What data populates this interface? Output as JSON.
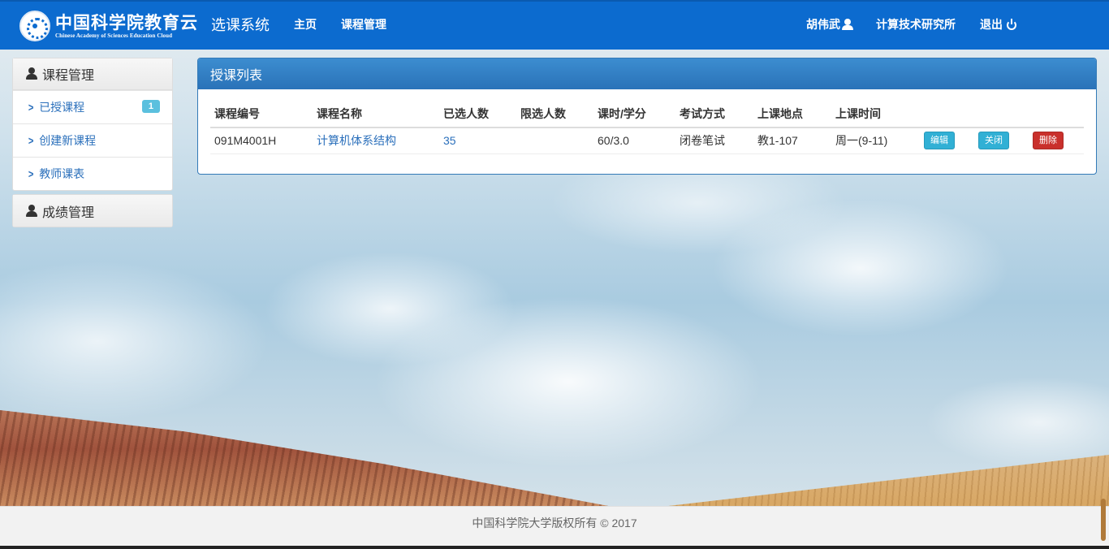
{
  "brand": {
    "name_cn": "中国科学院教育云",
    "name_en": "Chinese Academy of Sciences Education Cloud"
  },
  "navbar": {
    "system_title": "选课系统",
    "home": "主页",
    "course_management": "课程管理",
    "user_name": "胡伟武",
    "institute": "计算技术研究所",
    "logout": "退出"
  },
  "sidebar": {
    "course_panel": {
      "title": "课程管理",
      "items": [
        {
          "label": "已授课程",
          "badge": "1"
        },
        {
          "label": "创建新课程"
        },
        {
          "label": "教师课表"
        }
      ]
    },
    "grade_panel": {
      "title": "成绩管理"
    }
  },
  "main": {
    "title": "授课列表",
    "columns": [
      "课程编号",
      "课程名称",
      "已选人数",
      "限选人数",
      "课时/学分",
      "考试方式",
      "上课地点",
      "上课时间"
    ],
    "rows": [
      {
        "course_id": "091M4001H",
        "course_name": "计算机体系结构",
        "enrolled": "35",
        "limit": "",
        "hours_credits": "60/3.0",
        "exam_type": "闭卷笔试",
        "location": "教1-107",
        "time": "周一(9-11)",
        "actions": {
          "edit": "编辑",
          "close": "关闭",
          "delete": "删除"
        }
      }
    ]
  },
  "footer": {
    "copyright": "中国科学院大学版权所有 © 2017"
  },
  "colors": {
    "navbar": "#0c6bcf",
    "panel_header": "#2a72b8",
    "link": "#2a6fbb",
    "info_button": "#31b0d5",
    "danger_button": "#c9302c",
    "badge": "#5bc0de"
  }
}
